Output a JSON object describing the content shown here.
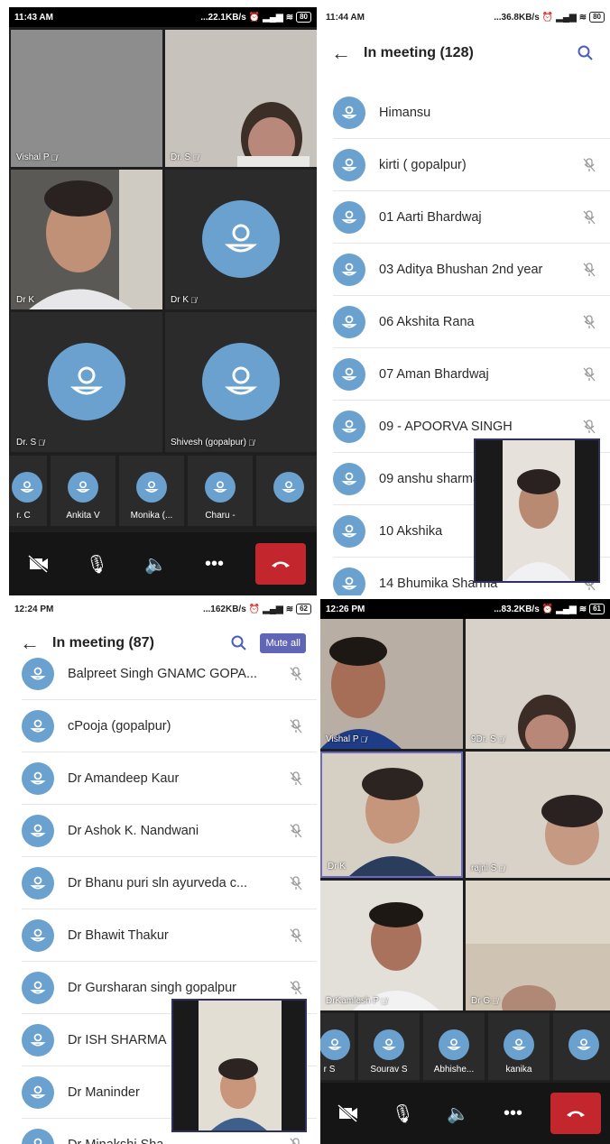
{
  "panel1": {
    "status": {
      "time": "11:43 AM",
      "speed": "...22.1KB/s",
      "battery": "80"
    },
    "tiles": [
      {
        "name": "Vishal P",
        "muted": true
      },
      {
        "name": "Dr. S",
        "muted": true
      },
      {
        "name": "Dr K",
        "muted": false
      },
      {
        "name": "Dr K",
        "muted": true
      },
      {
        "name": "Dr. S",
        "muted": true
      },
      {
        "name": "Shivesh (gopalpur)",
        "muted": true
      }
    ],
    "strip": [
      "r. C",
      "Ankita V",
      "Monika (...",
      "Charu -",
      ""
    ]
  },
  "panel2": {
    "status": {
      "time": "11:44 AM",
      "speed": "...36.8KB/s",
      "battery": "80"
    },
    "title": "In meeting (128)",
    "participants": [
      "Himansu",
      "kirti  ( gopalpur)",
      "01 Aarti Bhardwaj",
      "03 Aditya Bhushan 2nd year",
      "06 Akshita Rana",
      "07 Aman Bhardwaj",
      "09 - APOORVA  SINGH",
      "09 anshu sharma",
      "10 Akshika",
      "14 Bhumika Sharma"
    ]
  },
  "panel3": {
    "status": {
      "time": "12:24 PM",
      "speed": "...162KB/s",
      "battery": "62"
    },
    "title": "In meeting (87)",
    "mute_all": "Mute all",
    "participants": [
      "Balpreet Singh GNAMC GOPA...",
      "cPooja (gopalpur)",
      "Dr Amandeep Kaur",
      "Dr Ashok K. Nandwani",
      "Dr Bhanu puri sln ayurveda  c...",
      "Dr Bhawit Thakur",
      "Dr Gursharan singh gopalpur",
      "Dr ISH SHARMA",
      "Dr Maninder",
      "Dr Minakshi Sha"
    ]
  },
  "panel4": {
    "status": {
      "time": "12:26 PM",
      "speed": "...83.2KB/s",
      "battery": "61"
    },
    "tiles": [
      {
        "name": "Vishal P",
        "muted": true
      },
      {
        "name": "9Dr. S",
        "muted": true
      },
      {
        "name": "Dr K",
        "muted": false
      },
      {
        "name": "rajni S",
        "muted": true
      },
      {
        "name": "DrKamlesh P",
        "muted": true
      },
      {
        "name": "Dr G",
        "muted": true
      }
    ],
    "strip": [
      "r S",
      "Sourav S",
      "Abhishe...",
      "kanika",
      ""
    ]
  }
}
